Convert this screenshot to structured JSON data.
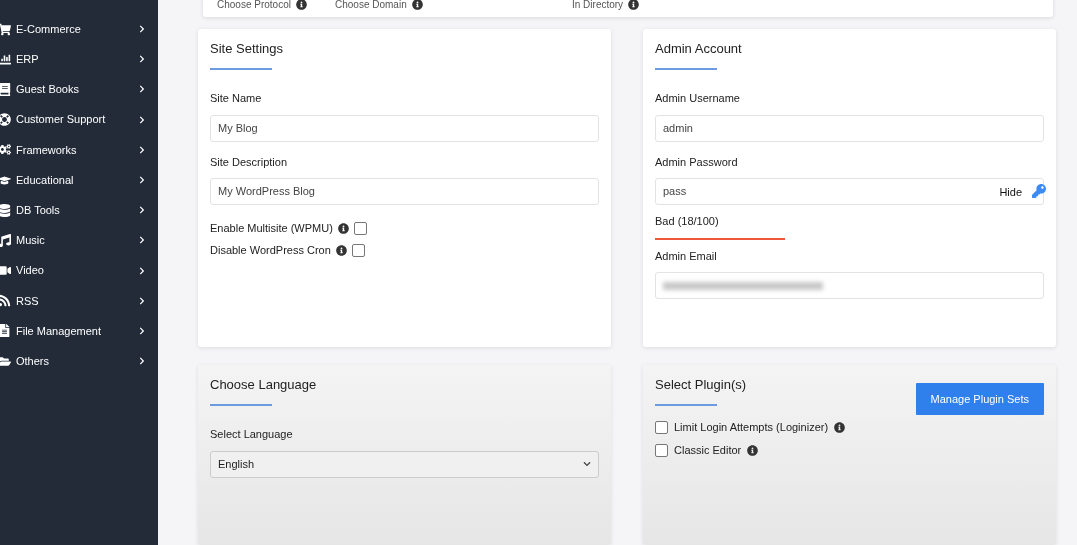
{
  "sidebar": {
    "items": [
      {
        "label": "E-Commerce"
      },
      {
        "label": "ERP"
      },
      {
        "label": "Guest Books"
      },
      {
        "label": "Customer Support"
      },
      {
        "label": "Frameworks"
      },
      {
        "label": "Educational"
      },
      {
        "label": "DB Tools"
      },
      {
        "label": "Music"
      },
      {
        "label": "Video"
      },
      {
        "label": "RSS"
      },
      {
        "label": "File Management"
      },
      {
        "label": "Others"
      }
    ]
  },
  "software_setup": {
    "labels": [
      "Choose Protocol",
      "Choose Domain",
      "In Directory"
    ]
  },
  "site_settings": {
    "title": "Site Settings",
    "fields": [
      {
        "label": "Site Name",
        "value": "My Blog"
      },
      {
        "label": "Site Description",
        "value": "My WordPress Blog"
      }
    ],
    "options": [
      {
        "label": "Enable Multisite (WPMU)",
        "checked": false
      },
      {
        "label": "Disable WordPress Cron",
        "checked": false
      }
    ]
  },
  "admin_account": {
    "title": "Admin Account",
    "username_label": "Admin Username",
    "username": "admin",
    "password_label": "Admin Password",
    "password": "pass",
    "toggle": "Hide",
    "strength": "Bad (18/100)",
    "email_label": "Admin Email"
  },
  "choose_language": {
    "title": "Choose Language",
    "label": "Select Language",
    "value": "English"
  },
  "select_plugins": {
    "title": "Select Plugin(s)",
    "button": "Manage Plugin Sets",
    "plugins": [
      {
        "label": "Limit Login Attempts (Loginizer)",
        "checked": false
      },
      {
        "label": "Classic Editor",
        "checked": false
      }
    ]
  }
}
